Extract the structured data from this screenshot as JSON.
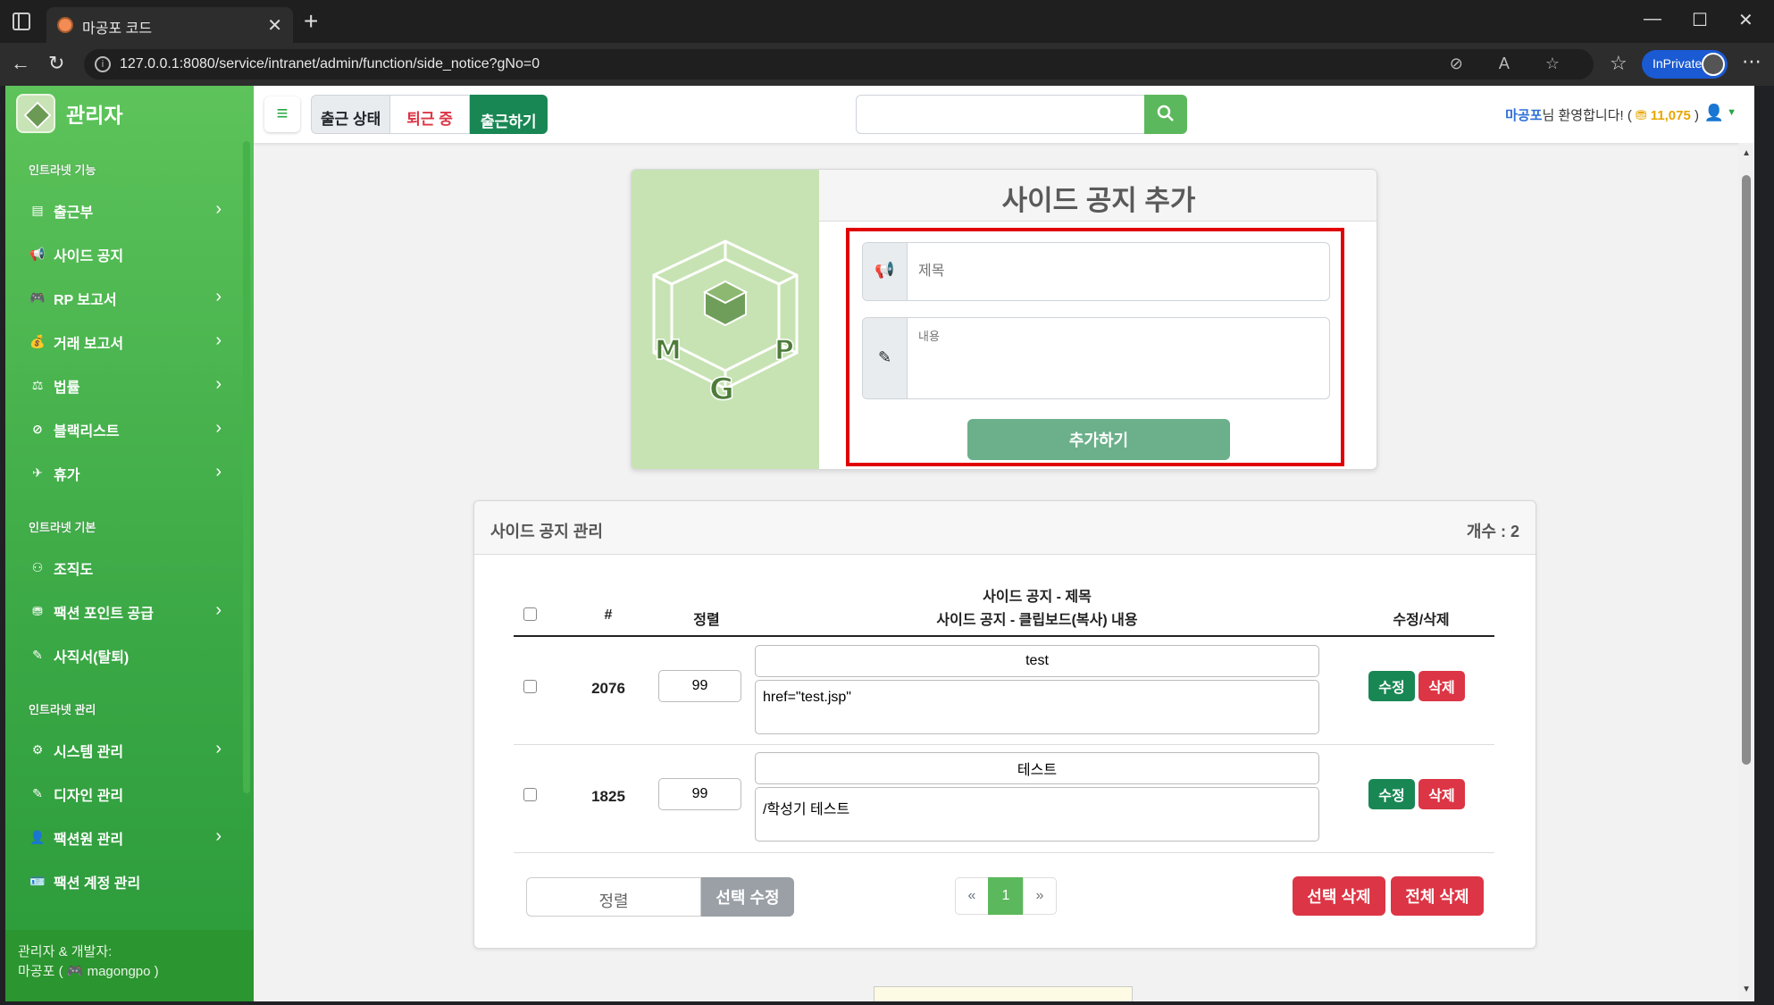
{
  "browser": {
    "tab_title": "마공포 코드",
    "url": "127.0.0.1:8080/service/intranet/admin/function/side_notice?gNo=0",
    "inprivate_label": "InPrivate"
  },
  "sidebar": {
    "brand": "관리자",
    "sections": [
      {
        "heading": "인트라넷 기능",
        "items": [
          {
            "label": "출근부",
            "icon": "book-icon",
            "glyph": "▤",
            "chevron": true
          },
          {
            "label": "사이드 공지",
            "icon": "megaphone-icon",
            "glyph": "📢",
            "chevron": false
          },
          {
            "label": "RP 보고서",
            "icon": "gamepad-icon",
            "glyph": "🎮",
            "chevron": true
          },
          {
            "label": "거래 보고서",
            "icon": "money-bag-icon",
            "glyph": "💰",
            "chevron": true
          },
          {
            "label": "법률",
            "icon": "scale-icon",
            "glyph": "⚖",
            "chevron": true
          },
          {
            "label": "블랙리스트",
            "icon": "ban-icon",
            "glyph": "⊘",
            "chevron": true
          },
          {
            "label": "휴가",
            "icon": "plane-icon",
            "glyph": "✈",
            "chevron": true
          }
        ]
      },
      {
        "heading": "인트라넷 기본",
        "items": [
          {
            "label": "조직도",
            "icon": "org-chart-icon",
            "glyph": "⚇",
            "chevron": false
          },
          {
            "label": "팩션 포인트 공급",
            "icon": "coins-icon",
            "glyph": "⛃",
            "chevron": true
          },
          {
            "label": "사직서(탈퇴)",
            "icon": "pen-icon",
            "glyph": "✎",
            "chevron": false
          }
        ]
      },
      {
        "heading": "인트라넷 관리",
        "items": [
          {
            "label": "시스템 관리",
            "icon": "gear-icon",
            "glyph": "⚙",
            "chevron": true
          },
          {
            "label": "디자인 관리",
            "icon": "brush-icon",
            "glyph": "✎",
            "chevron": false
          },
          {
            "label": "팩션원 관리",
            "icon": "user-gear-icon",
            "glyph": "👤",
            "chevron": true
          },
          {
            "label": "팩션 계정 관리",
            "icon": "id-card-icon",
            "glyph": "🪪",
            "chevron": false
          }
        ]
      }
    ],
    "footer_line1": "관리자 & 개발자:",
    "footer_line2": "마공포 ( 🎮 magongpo )"
  },
  "topbar": {
    "attendance_status_label": "출근 상태",
    "attendance_state": "퇴근 중",
    "clock_in_button": "출근하기",
    "search_placeholder": "",
    "user_name": "마공포",
    "welcome_text": "님 환영합니다! (",
    "points": "11,075",
    "points_suffix": ")"
  },
  "add_notice": {
    "title": "사이드 공지 추가",
    "title_placeholder": "제목",
    "content_placeholder": "내용",
    "submit_label": "추가하기"
  },
  "notice_list": {
    "title": "사이드 공지 관리",
    "count_text": "개수 : 2",
    "headers": {
      "id": "#",
      "sort": "정렬",
      "title_line1": "사이드 공지 - 제목",
      "title_line2": "사이드 공지 - 클립보드(복사) 내용",
      "actions": "수정/삭제"
    },
    "rows": [
      {
        "id": "2076",
        "sort": "99",
        "title": "test",
        "content": "href=\"test.jsp\""
      },
      {
        "id": "1825",
        "sort": "99",
        "title": "테스트",
        "content": "/학성기 테스트"
      }
    ],
    "edit_label": "수정",
    "delete_label": "삭제",
    "sort_label": "정렬",
    "select_edit_label": "선택 수정",
    "pagination": {
      "prev": "«",
      "current": "1",
      "next": "»"
    },
    "select_delete_label": "선택 삭제",
    "delete_all_label": "전체 삭제"
  },
  "colors": {
    "sidebar": "#3aa845",
    "primary_green": "#198754",
    "danger": "#dc3545",
    "highlight_frame": "#e00000"
  }
}
